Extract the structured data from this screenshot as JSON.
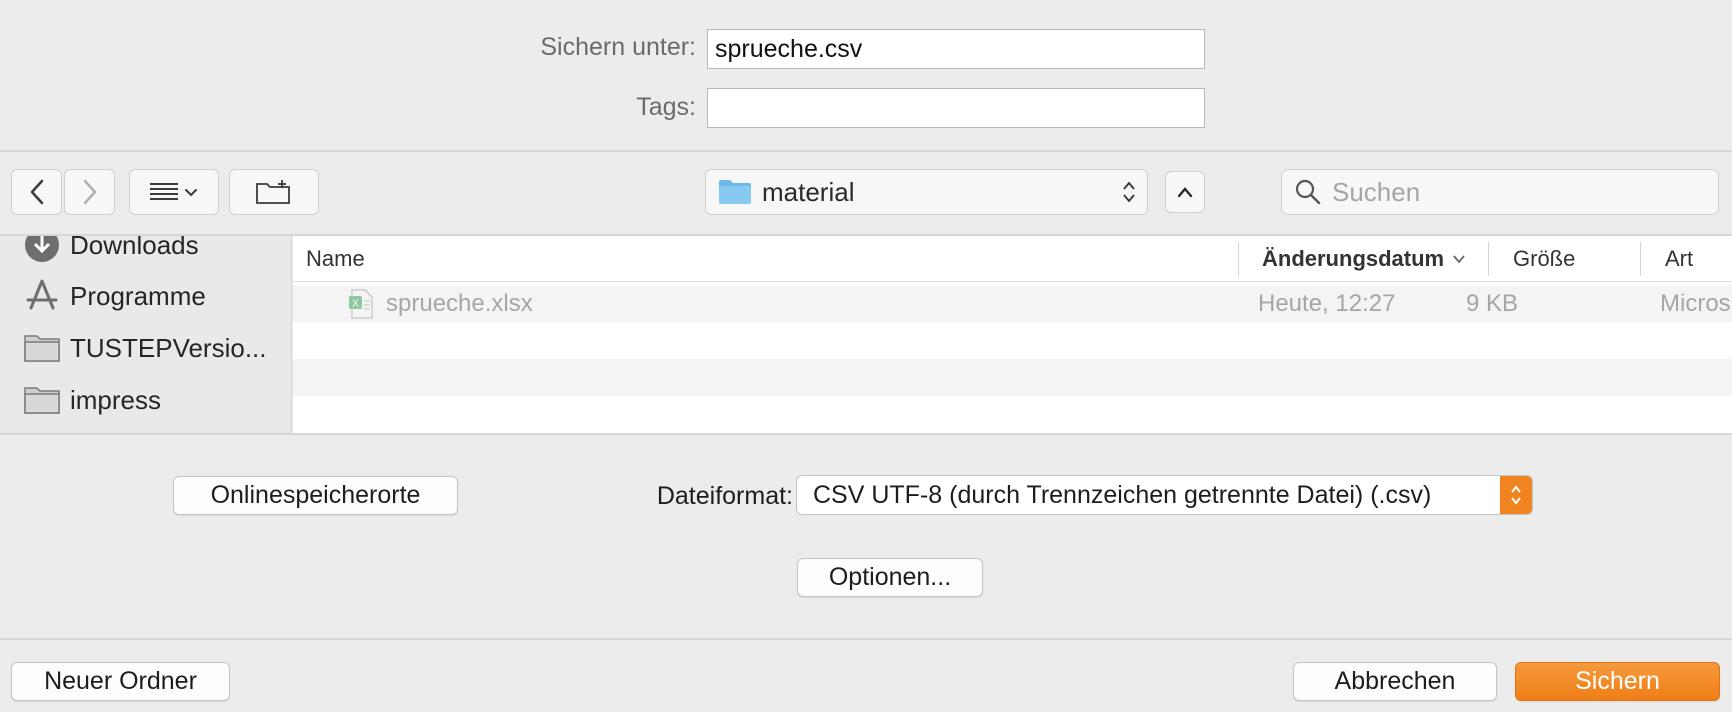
{
  "form": {
    "save_as_label": "Sichern unter:",
    "save_as_value": "sprueche.csv",
    "tags_label": "Tags:",
    "tags_value": ""
  },
  "toolbar": {
    "location": "material",
    "search_placeholder": "Suchen"
  },
  "sidebar": {
    "items": [
      {
        "label": "Downloads",
        "icon": "download-icon"
      },
      {
        "label": "Programme",
        "icon": "applications-icon"
      },
      {
        "label": "TUSTEPVersio...",
        "icon": "folder-icon"
      },
      {
        "label": "impress",
        "icon": "folder-icon"
      }
    ]
  },
  "file_list": {
    "columns": [
      "Name",
      "Änderungsdatum",
      "Größe",
      "Art"
    ],
    "rows": [
      {
        "name": "sprueche.xlsx",
        "date": "Heute, 12:27",
        "size": "9 KB",
        "kind": "Micros"
      }
    ]
  },
  "options": {
    "online_locations_label": "Onlinespeicherorte",
    "file_format_label": "Dateiformat:",
    "file_format_value": "CSV UTF-8 (durch Trennzeichen getrennte Datei) (.csv)",
    "options_button_label": "Optionen..."
  },
  "footer": {
    "new_folder_label": "Neuer Ordner",
    "cancel_label": "Abbrechen",
    "save_label": "Sichern"
  },
  "colors": {
    "accent": "#ef8420",
    "folder_blue": "#6cb8ec"
  }
}
